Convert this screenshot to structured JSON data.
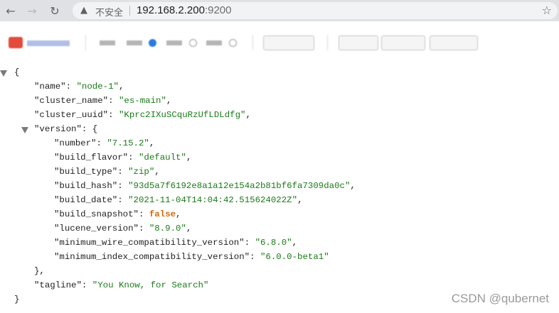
{
  "browser": {
    "back_glyph": "←",
    "forward_glyph": "→",
    "reload_glyph": "↻",
    "warning_glyph": "▲",
    "security_label": "不安全",
    "url_host": "192.168.2.200",
    "url_port": ":9200",
    "bookmark_glyph": "☆"
  },
  "json_lines": {
    "open_root": "{",
    "name_key": "\"name\"",
    "name_val": "\"node-1\"",
    "cluster_name_key": "\"cluster_name\"",
    "cluster_name_val": "\"es-main\"",
    "cluster_uuid_key": "\"cluster_uuid\"",
    "cluster_uuid_val": "\"Kprc2IXuSCquRzUfLDLdfg\"",
    "version_key": "\"version\"",
    "open_version": "{",
    "number_key": "\"number\"",
    "number_val": "\"7.15.2\"",
    "build_flavor_key": "\"build_flavor\"",
    "build_flavor_val": "\"default\"",
    "build_type_key": "\"build_type\"",
    "build_type_val": "\"zip\"",
    "build_hash_key": "\"build_hash\"",
    "build_hash_val": "\"93d5a7f6192e8a1a12e154a2b81bf6fa7309da0c\"",
    "build_date_key": "\"build_date\"",
    "build_date_val": "\"2021-11-04T14:04:42.515624022Z\"",
    "build_snapshot_key": "\"build_snapshot\"",
    "build_snapshot_val": "false",
    "lucene_version_key": "\"lucene_version\"",
    "lucene_version_val": "\"8.9.0\"",
    "min_wire_key": "\"minimum_wire_compatibility_version\"",
    "min_wire_val": "\"6.8.0\"",
    "min_index_key": "\"minimum_index_compatibility_version\"",
    "min_index_val": "\"6.0.0-beta1\"",
    "close_version": "},",
    "tagline_key": "\"tagline\"",
    "tagline_val": "\"You Know, for Search\"",
    "close_root": "}"
  },
  "watermark": "CSDN @qubernet"
}
